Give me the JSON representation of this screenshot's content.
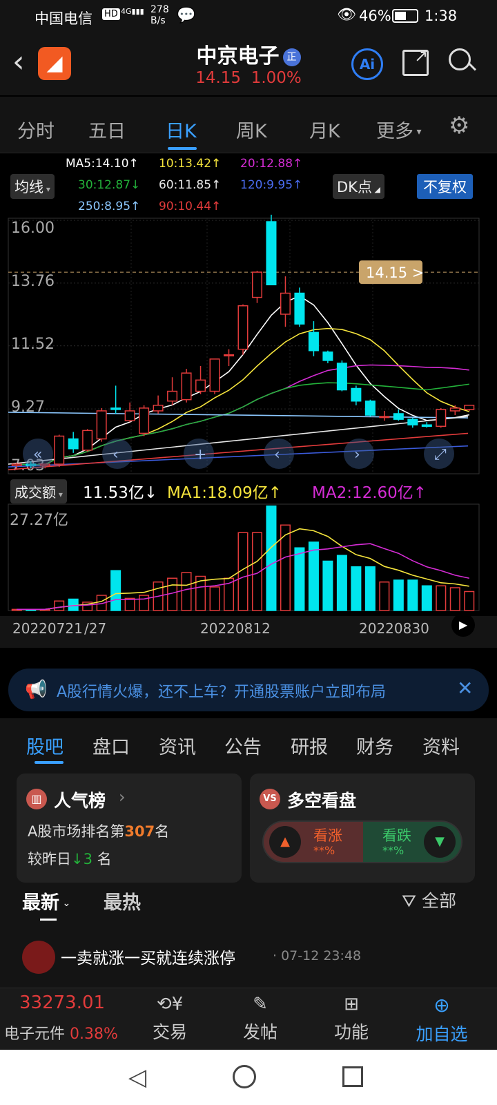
{
  "status": {
    "carrier": "中国电信",
    "net": "HD 4G",
    "speed": "278\nB/s",
    "battery": "46%",
    "time": "1:38"
  },
  "header": {
    "name": "中京电子",
    "badge": "正",
    "price": "14.15",
    "change": "1.00%",
    "ai_label": "Ai"
  },
  "tabs": [
    "分时",
    "五日",
    "日K",
    "周K",
    "月K",
    "更多"
  ],
  "active_tab": 2,
  "ma": {
    "selector": "均线",
    "ma5": "MA5:14.10↑",
    "ma10": "10:13.42↑",
    "ma20": "20:12.88↑",
    "ma30": "30:12.87↓",
    "ma60": "60:11.85↑",
    "ma120": "120:9.95↑",
    "ma250": "250:8.95↑",
    "ma90": "90:10.44↑",
    "dk": "DK点",
    "adjust": "不复权"
  },
  "price_axis": [
    "16.00",
    "13.76",
    "11.52",
    "9.27",
    "7.03"
  ],
  "current_marker": "14.15 >",
  "volume": {
    "selector": "成交额",
    "value": "11.53亿↓",
    "ma1": "MA1:18.09亿↑",
    "ma2": "MA2:12.60亿↑",
    "axis_top": "27.27亿"
  },
  "dates": [
    "20220721",
    "27",
    "20220812",
    "20220830"
  ],
  "colors": {
    "up": "#e23b3b",
    "down": "#00e5ee",
    "ma5": "#ffffff",
    "ma10": "#f5e43c",
    "ma20": "#d42cd4",
    "ma30": "#23b23a",
    "ma60": "#e6e6e6",
    "ma120": "#3b5bdb",
    "ma250": "#8cc8ff",
    "ma90": "#e23b3b"
  },
  "candles": [
    {
      "o": 7.25,
      "h": 7.35,
      "l": 7.1,
      "c": 7.3
    },
    {
      "o": 7.3,
      "h": 7.4,
      "l": 7.15,
      "c": 7.25
    },
    {
      "o": 7.25,
      "h": 7.3,
      "l": 7.15,
      "c": 7.3
    },
    {
      "o": 7.3,
      "h": 8.35,
      "l": 7.2,
      "c": 8.3
    },
    {
      "o": 8.2,
      "h": 8.45,
      "l": 7.7,
      "c": 7.85
    },
    {
      "o": 7.8,
      "h": 8.55,
      "l": 7.75,
      "c": 8.5
    },
    {
      "o": 8.2,
      "h": 9.3,
      "l": 8.1,
      "c": 9.2
    },
    {
      "o": 9.3,
      "h": 10.1,
      "l": 9.1,
      "c": 9.25
    },
    {
      "o": 8.85,
      "h": 9.5,
      "l": 8.8,
      "c": 9.2
    },
    {
      "o": 8.4,
      "h": 9.4,
      "l": 8.3,
      "c": 9.3
    },
    {
      "o": 9.2,
      "h": 9.75,
      "l": 9.1,
      "c": 9.4
    },
    {
      "o": 9.55,
      "h": 10.4,
      "l": 9.4,
      "c": 9.9
    },
    {
      "o": 9.6,
      "h": 10.7,
      "l": 9.5,
      "c": 10.55
    },
    {
      "o": 9.9,
      "h": 10.8,
      "l": 9.8,
      "c": 10.3
    },
    {
      "o": 9.9,
      "h": 11.05,
      "l": 9.8,
      "c": 11.05
    },
    {
      "o": 11.2,
      "h": 11.4,
      "l": 10.8,
      "c": 11.2
    },
    {
      "o": 11.4,
      "h": 13.0,
      "l": 11.2,
      "c": 12.95
    },
    {
      "o": 13.25,
      "h": 14.2,
      "l": 13.05,
      "c": 14.15
    },
    {
      "o": 15.95,
      "h": 16.2,
      "l": 13.7,
      "c": 13.7
    },
    {
      "o": 12.65,
      "h": 14.0,
      "l": 12.2,
      "c": 13.4
    },
    {
      "o": 13.4,
      "h": 13.6,
      "l": 12.2,
      "c": 12.3
    },
    {
      "o": 12.0,
      "h": 12.4,
      "l": 11.15,
      "c": 11.35
    },
    {
      "o": 11.3,
      "h": 11.35,
      "l": 10.9,
      "c": 11.0
    },
    {
      "o": 10.9,
      "h": 11.0,
      "l": 9.9,
      "c": 9.95
    },
    {
      "o": 10.0,
      "h": 10.1,
      "l": 9.4,
      "c": 9.55
    },
    {
      "o": 9.55,
      "h": 9.6,
      "l": 9.0,
      "c": 9.05
    },
    {
      "o": 9.0,
      "h": 9.2,
      "l": 8.85,
      "c": 9.0
    },
    {
      "o": 9.1,
      "h": 9.25,
      "l": 8.85,
      "c": 8.9
    },
    {
      "o": 8.9,
      "h": 8.95,
      "l": 8.6,
      "c": 8.7
    },
    {
      "o": 8.7,
      "h": 8.8,
      "l": 8.6,
      "c": 8.65
    },
    {
      "o": 8.65,
      "h": 9.3,
      "l": 8.6,
      "c": 9.25
    },
    {
      "o": 9.2,
      "h": 9.4,
      "l": 9.05,
      "c": 9.3
    },
    {
      "o": 9.25,
      "h": 9.4,
      "l": 9.2,
      "c": 9.4
    }
  ],
  "volumes": [
    0.3,
    0.3,
    0.3,
    2.5,
    3.0,
    2.2,
    4.0,
    10.5,
    3.2,
    4.0,
    7.5,
    8.5,
    10.0,
    9.0,
    6.2,
    8.5,
    20.5,
    20.5,
    27.5,
    22.5,
    16.5,
    18.0,
    13.0,
    14.5,
    11.5,
    11.5,
    7.5,
    8.0,
    8.0,
    6.5,
    6.5,
    6.0,
    5.0
  ],
  "info_banner": "A股行情火爆，还不上车？开通股票账户立即布局",
  "subtabs": [
    "股吧",
    "盘口",
    "资讯",
    "公告",
    "研报",
    "财务",
    "资料"
  ],
  "popular": {
    "title": "人气榜",
    "rank_prefix": "A股市场排名第",
    "rank": "307",
    "rank_suffix": "名",
    "change_prefix": "较昨日",
    "change": "3",
    "change_suffix": "名"
  },
  "sentiment": {
    "title": "多空看盘",
    "bull": "看涨",
    "bull_pct": "**%",
    "bear": "看跌",
    "bear_pct": "**%"
  },
  "feed": {
    "latest": "最新",
    "hot": "最热",
    "filter": "全部",
    "post_title": "一卖就涨一买就连续涨停",
    "post_time": "· 07-12 23:48"
  },
  "footer": {
    "index_value": "33273.01",
    "index_name": "电子元件",
    "index_change": "0.38%",
    "trade": "交易",
    "post": "发帖",
    "func": "功能",
    "add": "加自选"
  }
}
